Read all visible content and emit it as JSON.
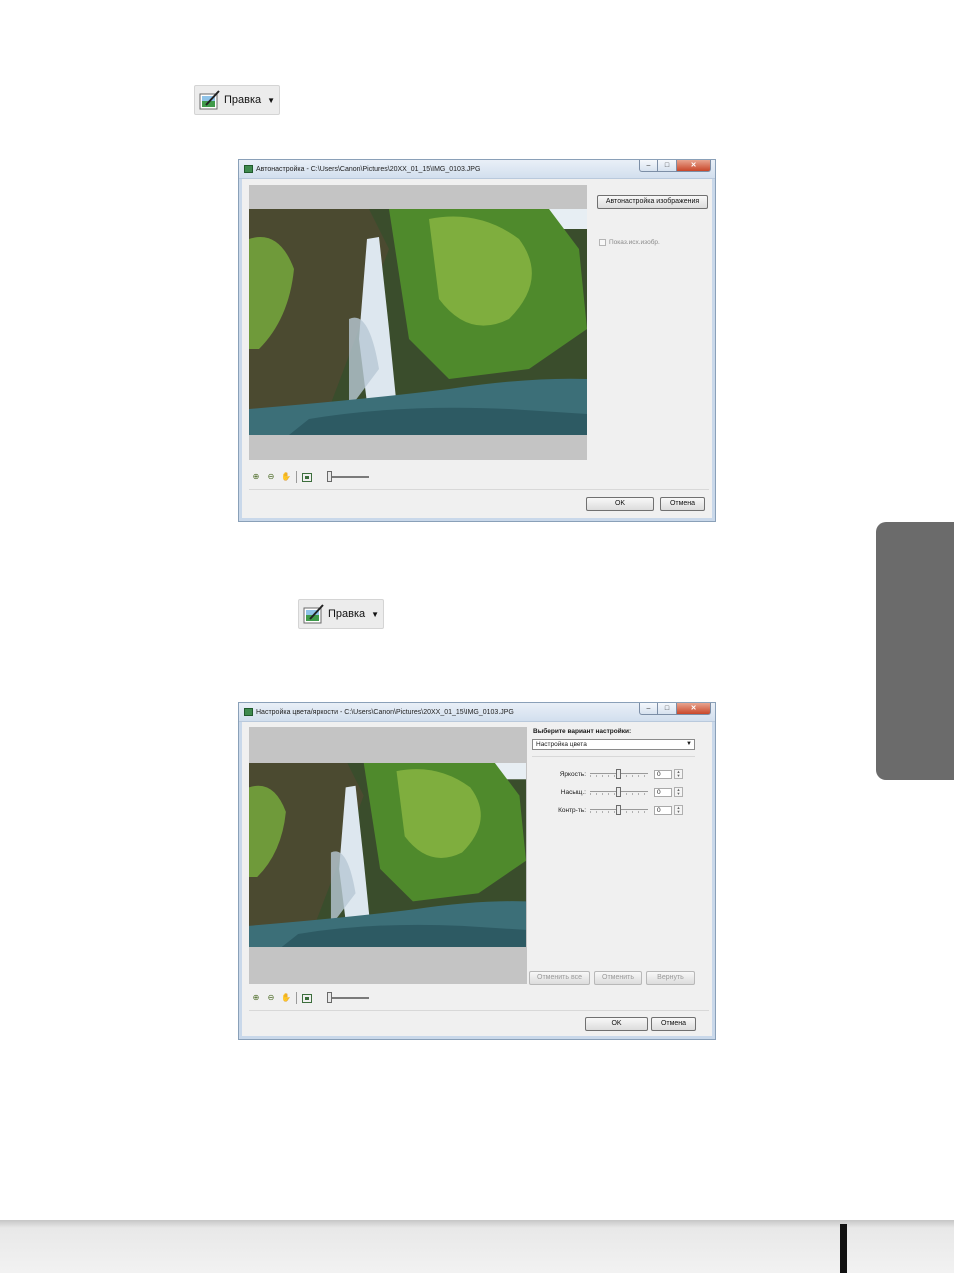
{
  "edit_button": {
    "label": "Правка",
    "icon": "edit-image-icon"
  },
  "window1": {
    "title": "Автонастройка - C:\\Users\\Canon\\Pictures\\20XX_01_15\\IMG_0103.JPG",
    "auto_adjust_button": "Автонастройка изображения",
    "show_original_checkbox": "Показ.исх.изобр.",
    "ok_button": "OK",
    "cancel_button": "Отмена"
  },
  "window2": {
    "title": "Настройка цвета/яркости - C:\\Users\\Canon\\Pictures\\20XX_01_15\\IMG_0103.JPG",
    "select_label": "Выберите вариант настройки:",
    "select_value": "Настройка цвета",
    "sliders": [
      {
        "label": "Яркость:",
        "value": "0"
      },
      {
        "label": "Насыщ.:",
        "value": "0"
      },
      {
        "label": "Контр-ть:",
        "value": "0"
      }
    ],
    "undo_all_button": "Отменить все",
    "undo_button": "Отменить",
    "redo_button": "Вернуть",
    "ok_button": "OK",
    "cancel_button": "Отмена"
  },
  "colors": {
    "side_tab": "#6b6b6b",
    "window_border": "#8aa0b8",
    "preview_bg": "#c4c4c4",
    "close_button": "#c9472a"
  }
}
